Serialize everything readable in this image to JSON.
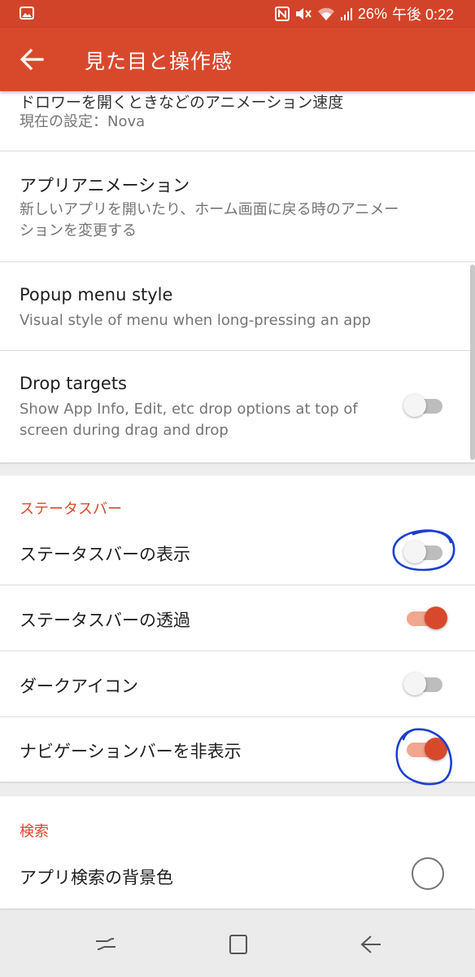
{
  "status_bar": {
    "battery": "26%",
    "time": "午後 0:22",
    "icons": [
      "gallery-icon",
      "nfc-icon",
      "mute-icon",
      "wifi-icon",
      "signal-icon"
    ]
  },
  "app_bar": {
    "title": "見た目と操作感",
    "back_icon": "arrow-back-icon"
  },
  "settings": {
    "drawer_animation": {
      "title": "ドロワーを開くときなどのアニメーション速度",
      "summary": "現在の設定：Nova"
    },
    "app_animation": {
      "title": "アプリアニメーション",
      "summary_line1": "新しいアプリを開いたり、ホーム画面に戻る時のアニメー",
      "summary_line2": "ションを変更する"
    },
    "popup_menu_style": {
      "title": "Popup menu style",
      "summary": "Visual style of menu when long-pressing an app"
    },
    "drop_targets": {
      "title": "Drop targets",
      "summary_line1": "Show App Info, Edit, etc drop options at top of",
      "summary_line2": "screen during drag and drop",
      "enabled": false
    }
  },
  "statusbar_section": {
    "header": "ステータスバー",
    "items": [
      {
        "label": "ステータスバーの表示",
        "enabled": false
      },
      {
        "label": "ステータスバーの透過",
        "enabled": true
      },
      {
        "label": "ダークアイコン",
        "enabled": false
      },
      {
        "label": "ナビゲーションバーを非表示",
        "enabled": true
      }
    ]
  },
  "search_section": {
    "header": "検索",
    "items": [
      {
        "label": "アプリ検索の背景色"
      }
    ]
  },
  "colors": {
    "accent": "#d8492c",
    "status_bar": "#d2442a",
    "annotation": "#1a3fd0"
  },
  "nav_bar": {
    "icons": [
      "recent-apps-icon",
      "home-icon",
      "back-icon"
    ]
  }
}
